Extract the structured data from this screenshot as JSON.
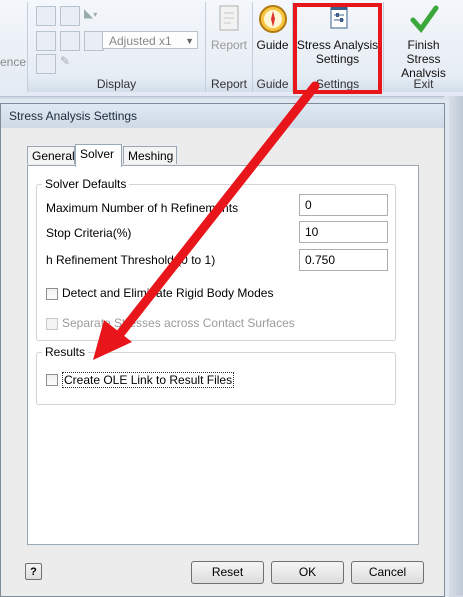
{
  "ribbon": {
    "partial_left_label": "ence",
    "display": {
      "combo_value": "Adjusted x1",
      "group_label": "Display"
    },
    "report": {
      "button_label": "Report",
      "group_label": "Report"
    },
    "guide": {
      "button_label": "Guide",
      "group_label": "Guide"
    },
    "settings": {
      "button_label_line1": "Stress Analysis",
      "button_label_line2": "Settings",
      "group_label": "Settings"
    },
    "exit": {
      "button_label_line1": "Finish",
      "button_label_line2": "Stress Analysis",
      "group_label": "Exit"
    }
  },
  "dialog": {
    "title": "Stress Analysis Settings",
    "tabs": [
      "General",
      "Solver",
      "Meshing"
    ],
    "active_tab": "Solver",
    "solver_defaults": {
      "legend": "Solver Defaults",
      "max_h_label": "Maximum Number of h Refinements",
      "max_h_value": "0",
      "stop_label": "Stop Criteria(%)",
      "stop_value": "10",
      "threshold_label": "h Refinement Threshold (0 to 1)",
      "threshold_value": "0.750",
      "detect_label": "Detect and Eliminate Rigid Body Modes",
      "separate_label": "Separate Stresses across Contact Surfaces"
    },
    "results": {
      "legend": "Results",
      "ole_label": "Create OLE Link to Result Files"
    },
    "buttons": {
      "help": "?",
      "reset": "Reset",
      "ok": "OK",
      "cancel": "Cancel"
    }
  },
  "colors": {
    "callout": "#e8151a",
    "ribbon_bg": "#e8eef5",
    "finish_check": "#3aa73a"
  },
  "icons": [
    "report-icon",
    "guide-compass-icon",
    "stress-settings-icon",
    "finish-check-icon"
  ]
}
